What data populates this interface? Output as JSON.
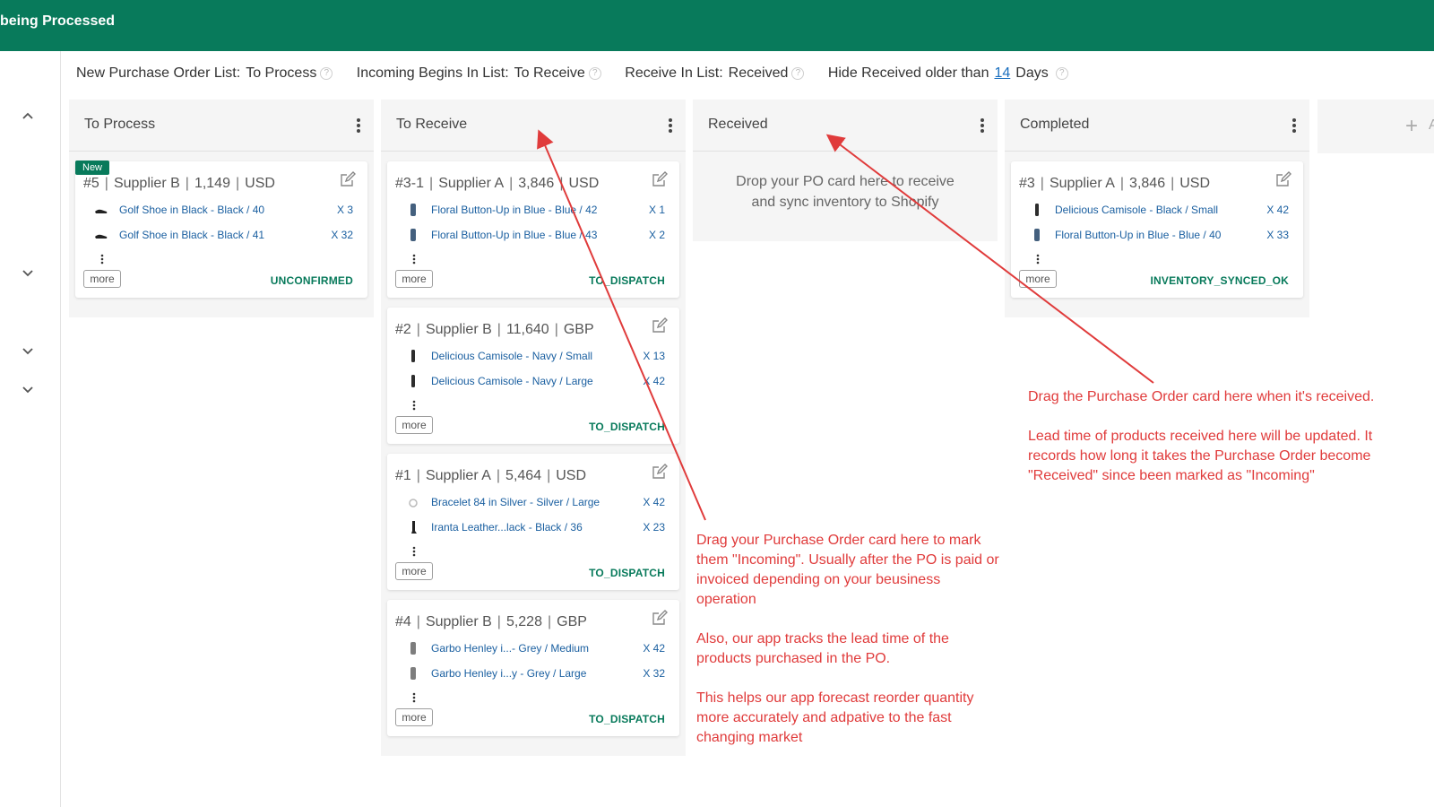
{
  "header": {
    "title": "being Processed"
  },
  "settings": {
    "new_po": {
      "label": "New Purchase Order List:",
      "value": "To Process"
    },
    "incoming": {
      "label": "Incoming Begins In List:",
      "value": "To Receive"
    },
    "receive": {
      "label": "Receive In List:",
      "value": "Received"
    },
    "hide": {
      "label": "Hide Received older than",
      "days": "14",
      "unit": "Days"
    }
  },
  "columns": {
    "to_process": {
      "title": "To Process"
    },
    "to_receive": {
      "title": "To Receive"
    },
    "received": {
      "title": "Received",
      "drop_hint_1": "Drop your PO card here to receive",
      "drop_hint_2": "and sync inventory to Shopify"
    },
    "completed": {
      "title": "Completed"
    },
    "add": {
      "label": "A"
    }
  },
  "cards": {
    "c5": {
      "badge": "New",
      "num": "#5",
      "supplier": "Supplier B",
      "amount": "1,149",
      "currency": "USD",
      "lines": [
        {
          "name": "Golf Shoe in Black - Black / 40",
          "qty": "X 3",
          "icon": "shoe-thumbnail-icon"
        },
        {
          "name": "Golf Shoe in Black - Black / 41",
          "qty": "X 32",
          "icon": "shoe-thumbnail-icon"
        }
      ],
      "more": "more",
      "status": "UNCONFIRMED"
    },
    "c31": {
      "num": "#3-1",
      "supplier": "Supplier A",
      "amount": "3,846",
      "currency": "USD",
      "lines": [
        {
          "name": "Floral Button-Up in Blue - Blue / 42",
          "qty": "X 1",
          "icon": "shirt-thumbnail-icon"
        },
        {
          "name": "Floral Button-Up in Blue - Blue / 43",
          "qty": "X 2",
          "icon": "shirt-thumbnail-icon"
        }
      ],
      "more": "more",
      "status": "TO_DISPATCH"
    },
    "c2": {
      "num": "#2",
      "supplier": "Supplier B",
      "amount": "11,640",
      "currency": "GBP",
      "lines": [
        {
          "name": "Delicious Camisole - Navy / Small",
          "qty": "X 13",
          "icon": "camisole-thumbnail-icon"
        },
        {
          "name": "Delicious Camisole - Navy / Large",
          "qty": "X 42",
          "icon": "camisole-thumbnail-icon"
        }
      ],
      "more": "more",
      "status": "TO_DISPATCH"
    },
    "c1": {
      "num": "#1",
      "supplier": "Supplier A",
      "amount": "5,464",
      "currency": "USD",
      "lines": [
        {
          "name": "Bracelet 84 in Silver - Silver / Large",
          "qty": "X 42",
          "icon": "bracelet-thumbnail-icon"
        },
        {
          "name": "Iranta Leather...lack - Black / 36",
          "qty": "X 23",
          "icon": "boot-thumbnail-icon"
        }
      ],
      "more": "more",
      "status": "TO_DISPATCH"
    },
    "c4": {
      "num": "#4",
      "supplier": "Supplier B",
      "amount": "5,228",
      "currency": "GBP",
      "lines": [
        {
          "name": "Garbo Henley i...- Grey / Medium",
          "qty": "X 42",
          "icon": "henley-thumbnail-icon"
        },
        {
          "name": "Garbo Henley i...y - Grey / Large",
          "qty": "X 32",
          "icon": "henley-thumbnail-icon"
        }
      ],
      "more": "more",
      "status": "TO_DISPATCH"
    },
    "c3": {
      "num": "#3",
      "supplier": "Supplier A",
      "amount": "3,846",
      "currency": "USD",
      "lines": [
        {
          "name": "Delicious Camisole - Black / Small",
          "qty": "X 42",
          "icon": "camisole-thumbnail-icon"
        },
        {
          "name": "Floral Button-Up in Blue - Blue / 40",
          "qty": "X 33",
          "icon": "shirt-thumbnail-icon"
        }
      ],
      "more": "more",
      "status": "INVENTORY_SYNCED_OK"
    }
  },
  "annotations": {
    "incoming": {
      "p1": "Drag your Purchase Order card here to mark them \"Incoming\". Usually after the PO is paid or invoiced depending on your beusiness operation",
      "p2": "Also, our app tracks the lead time of the products purchased in the PO.",
      "p3": "This helps our app forecast reorder quantity more accurately and adpative to the fast changing market"
    },
    "received": {
      "p1": "Drag the Purchase Order card here when it's received.",
      "p2": "Lead time of products received here will be updated. It records how long it takes the Purchase Order become \"Received\" since been marked as \"Incoming\""
    }
  },
  "colors": {
    "brand": "#087a5b",
    "link": "#1a5fa0",
    "annotation": "#e03b3b"
  }
}
